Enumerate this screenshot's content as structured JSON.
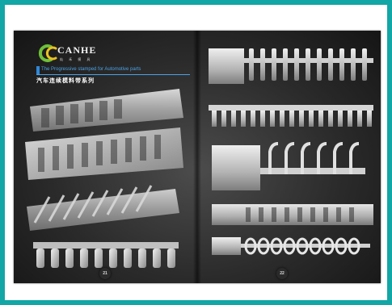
{
  "brand": {
    "name": "CANHE",
    "subtitle": "灿 禾 模 具"
  },
  "left_page": {
    "tagline": "The Progressive stamped for Automotive parts",
    "title_cn": "汽车连续模料带系列",
    "page_number": "21"
  },
  "right_page": {
    "page_number": "22"
  },
  "colors": {
    "outer_border": "#12a6a6",
    "page_background": "#2b2b2b",
    "accent_blue": "#2f88d8",
    "logo_green": "#6fbf3a",
    "logo_yellow": "#e8c21f"
  }
}
